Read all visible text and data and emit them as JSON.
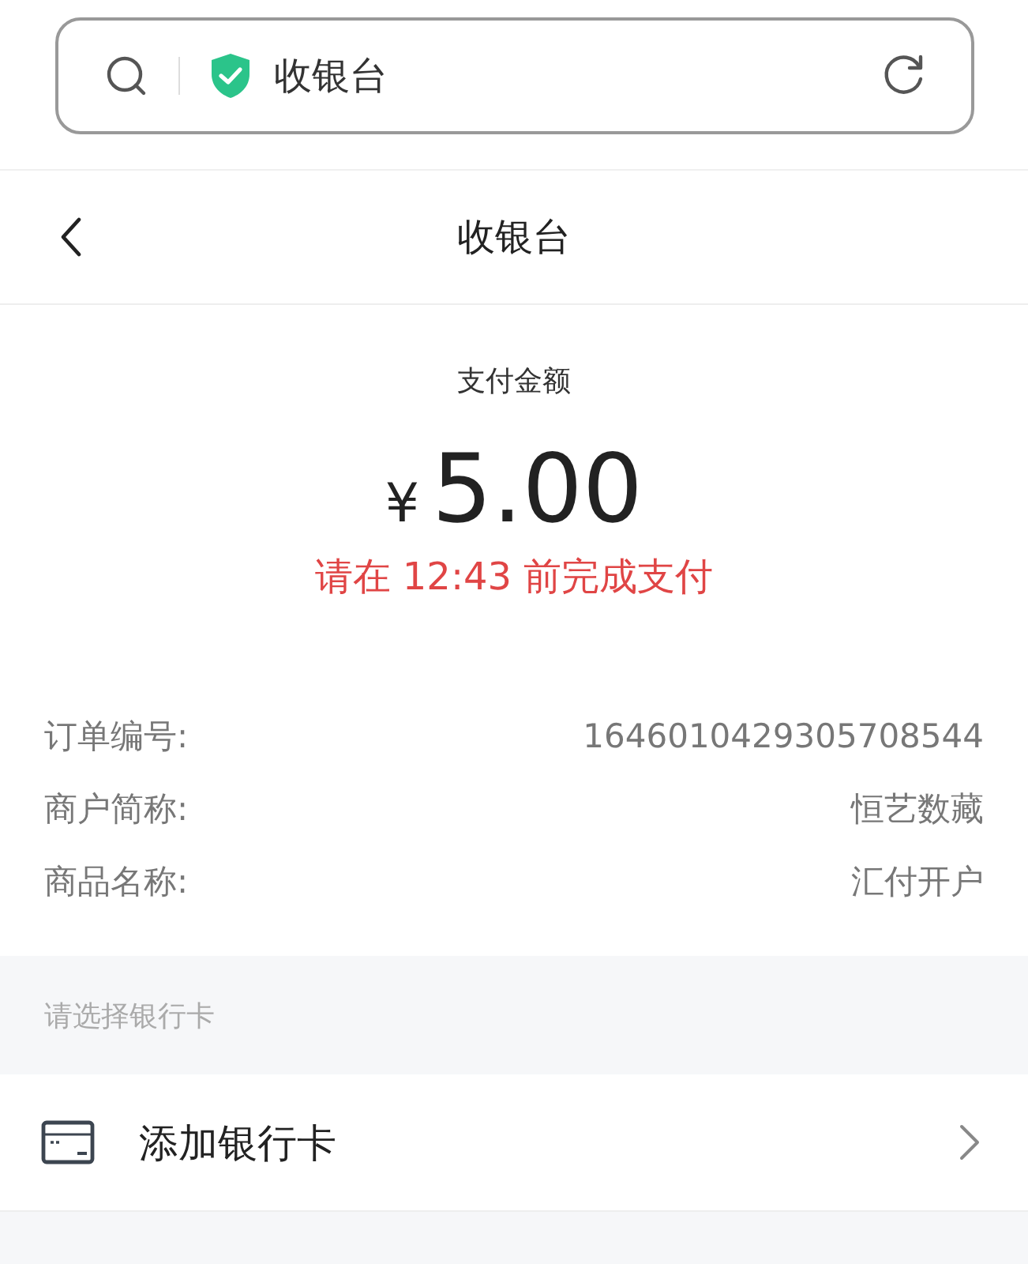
{
  "address_bar": {
    "title": "收银台",
    "secure": true
  },
  "nav": {
    "title": "收银台"
  },
  "payment": {
    "label": "支付金额",
    "currency": "¥",
    "amount": "5.00",
    "deadline": "请在 12:43 前完成支付"
  },
  "details": [
    {
      "label": "订单编号:",
      "value": "1646010429305708544"
    },
    {
      "label": "商户简称:",
      "value": "恒艺数藏"
    },
    {
      "label": "商品名称:",
      "value": "汇付开户"
    }
  ],
  "bank_section": {
    "hint": "请选择银行卡",
    "add_card": "添加银行卡"
  }
}
